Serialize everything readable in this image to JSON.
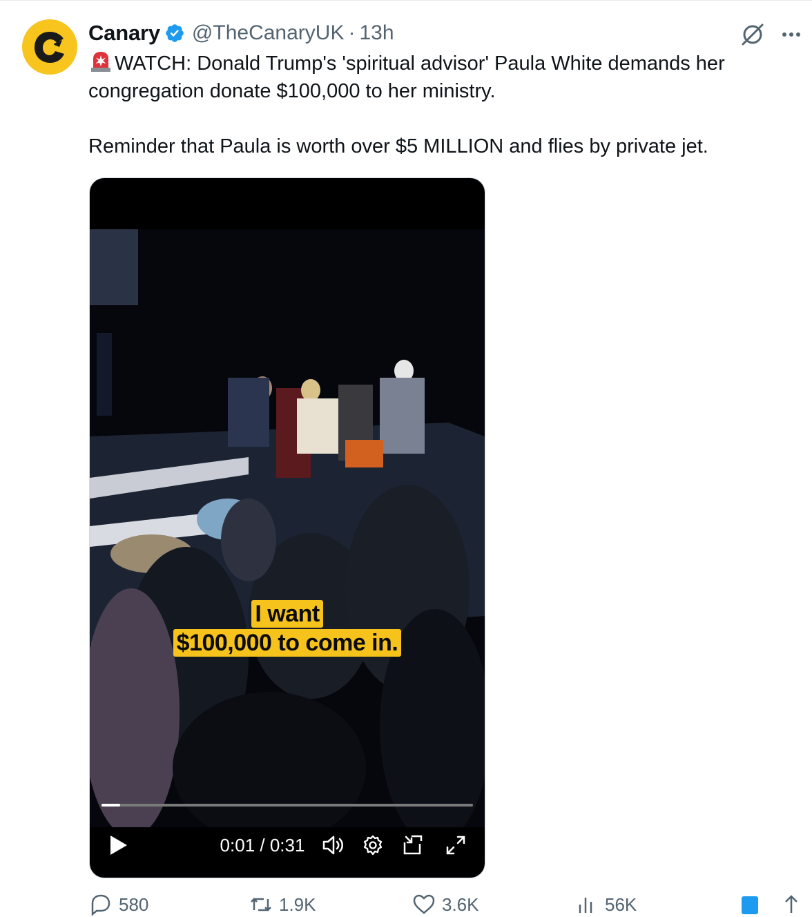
{
  "tweet": {
    "author": "Canary",
    "handle": "@TheCanaryUK",
    "separator": "·",
    "time": "13h",
    "line1": "WATCH: Donald Trump's 'spiritual advisor' Paula White demands her congregation donate $100,000 to her ministry.",
    "line2": "Reminder that Paula is worth over $5 MILLION and flies by private jet."
  },
  "video": {
    "caption_line1": "I want",
    "caption_line2": "$100,000 to come in.",
    "timecode": "0:01 / 0:31",
    "progress": 0.05
  },
  "actions": {
    "replies": "580",
    "reposts": "1.9K",
    "likes": "3.6K",
    "views": "56K"
  },
  "colors": {
    "brand_yellow": "#f7c51e",
    "verified_blue": "#1d9bf0",
    "caption_bg": "#f6c21c",
    "secondary_text": "#536471"
  },
  "icons": [
    "canary-logo-icon",
    "verified-badge-icon",
    "grok-icon",
    "more-icon",
    "siren-icon",
    "play-icon",
    "volume-icon",
    "settings-icon",
    "pip-icon",
    "fullscreen-icon",
    "reply-icon",
    "repost-icon",
    "like-icon",
    "views-icon",
    "bookmark-icon",
    "share-icon"
  ]
}
